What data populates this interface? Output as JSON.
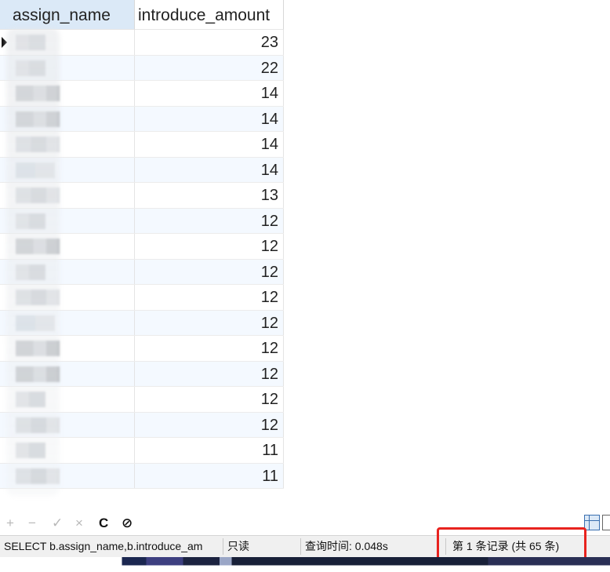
{
  "grid": {
    "columns": [
      "assign_name",
      "introduce_amount"
    ],
    "rows": [
      {
        "name": "",
        "amount": "23"
      },
      {
        "name": "",
        "amount": "22"
      },
      {
        "name": "",
        "amount": "14"
      },
      {
        "name": "",
        "amount": "14"
      },
      {
        "name": "",
        "amount": "14"
      },
      {
        "name": "",
        "amount": "14"
      },
      {
        "name": "",
        "amount": "13"
      },
      {
        "name": "",
        "amount": "12"
      },
      {
        "name": "",
        "amount": "12"
      },
      {
        "name": "",
        "amount": "12"
      },
      {
        "name": "",
        "amount": "12"
      },
      {
        "name": "",
        "amount": "12"
      },
      {
        "name": "",
        "amount": "12"
      },
      {
        "name": "",
        "amount": "12"
      },
      {
        "name": "",
        "amount": "12"
      },
      {
        "name": "",
        "amount": "12"
      },
      {
        "name": "",
        "amount": "11"
      },
      {
        "name": "",
        "amount": "11"
      }
    ]
  },
  "toolbar": {
    "add": "+",
    "remove": "−",
    "apply": "✓",
    "discard": "×",
    "refresh": "C",
    "stop": "⊘",
    "icons": [
      "add-icon",
      "remove-icon",
      "check-icon",
      "close-icon",
      "refresh-icon",
      "stop-icon",
      "grid-view-icon",
      "form-view-icon"
    ]
  },
  "status": {
    "sql": "SELECT b.assign_name,b.introduce_am",
    "mode": "只读",
    "query_time": "查询时间: 0.048s",
    "record": "第 1 条记录 (共 65 条)"
  },
  "colors": {
    "header_selected": "#dbe9f7",
    "alt_row": "#f4f9ff",
    "highlight_box": "#e8231f"
  }
}
